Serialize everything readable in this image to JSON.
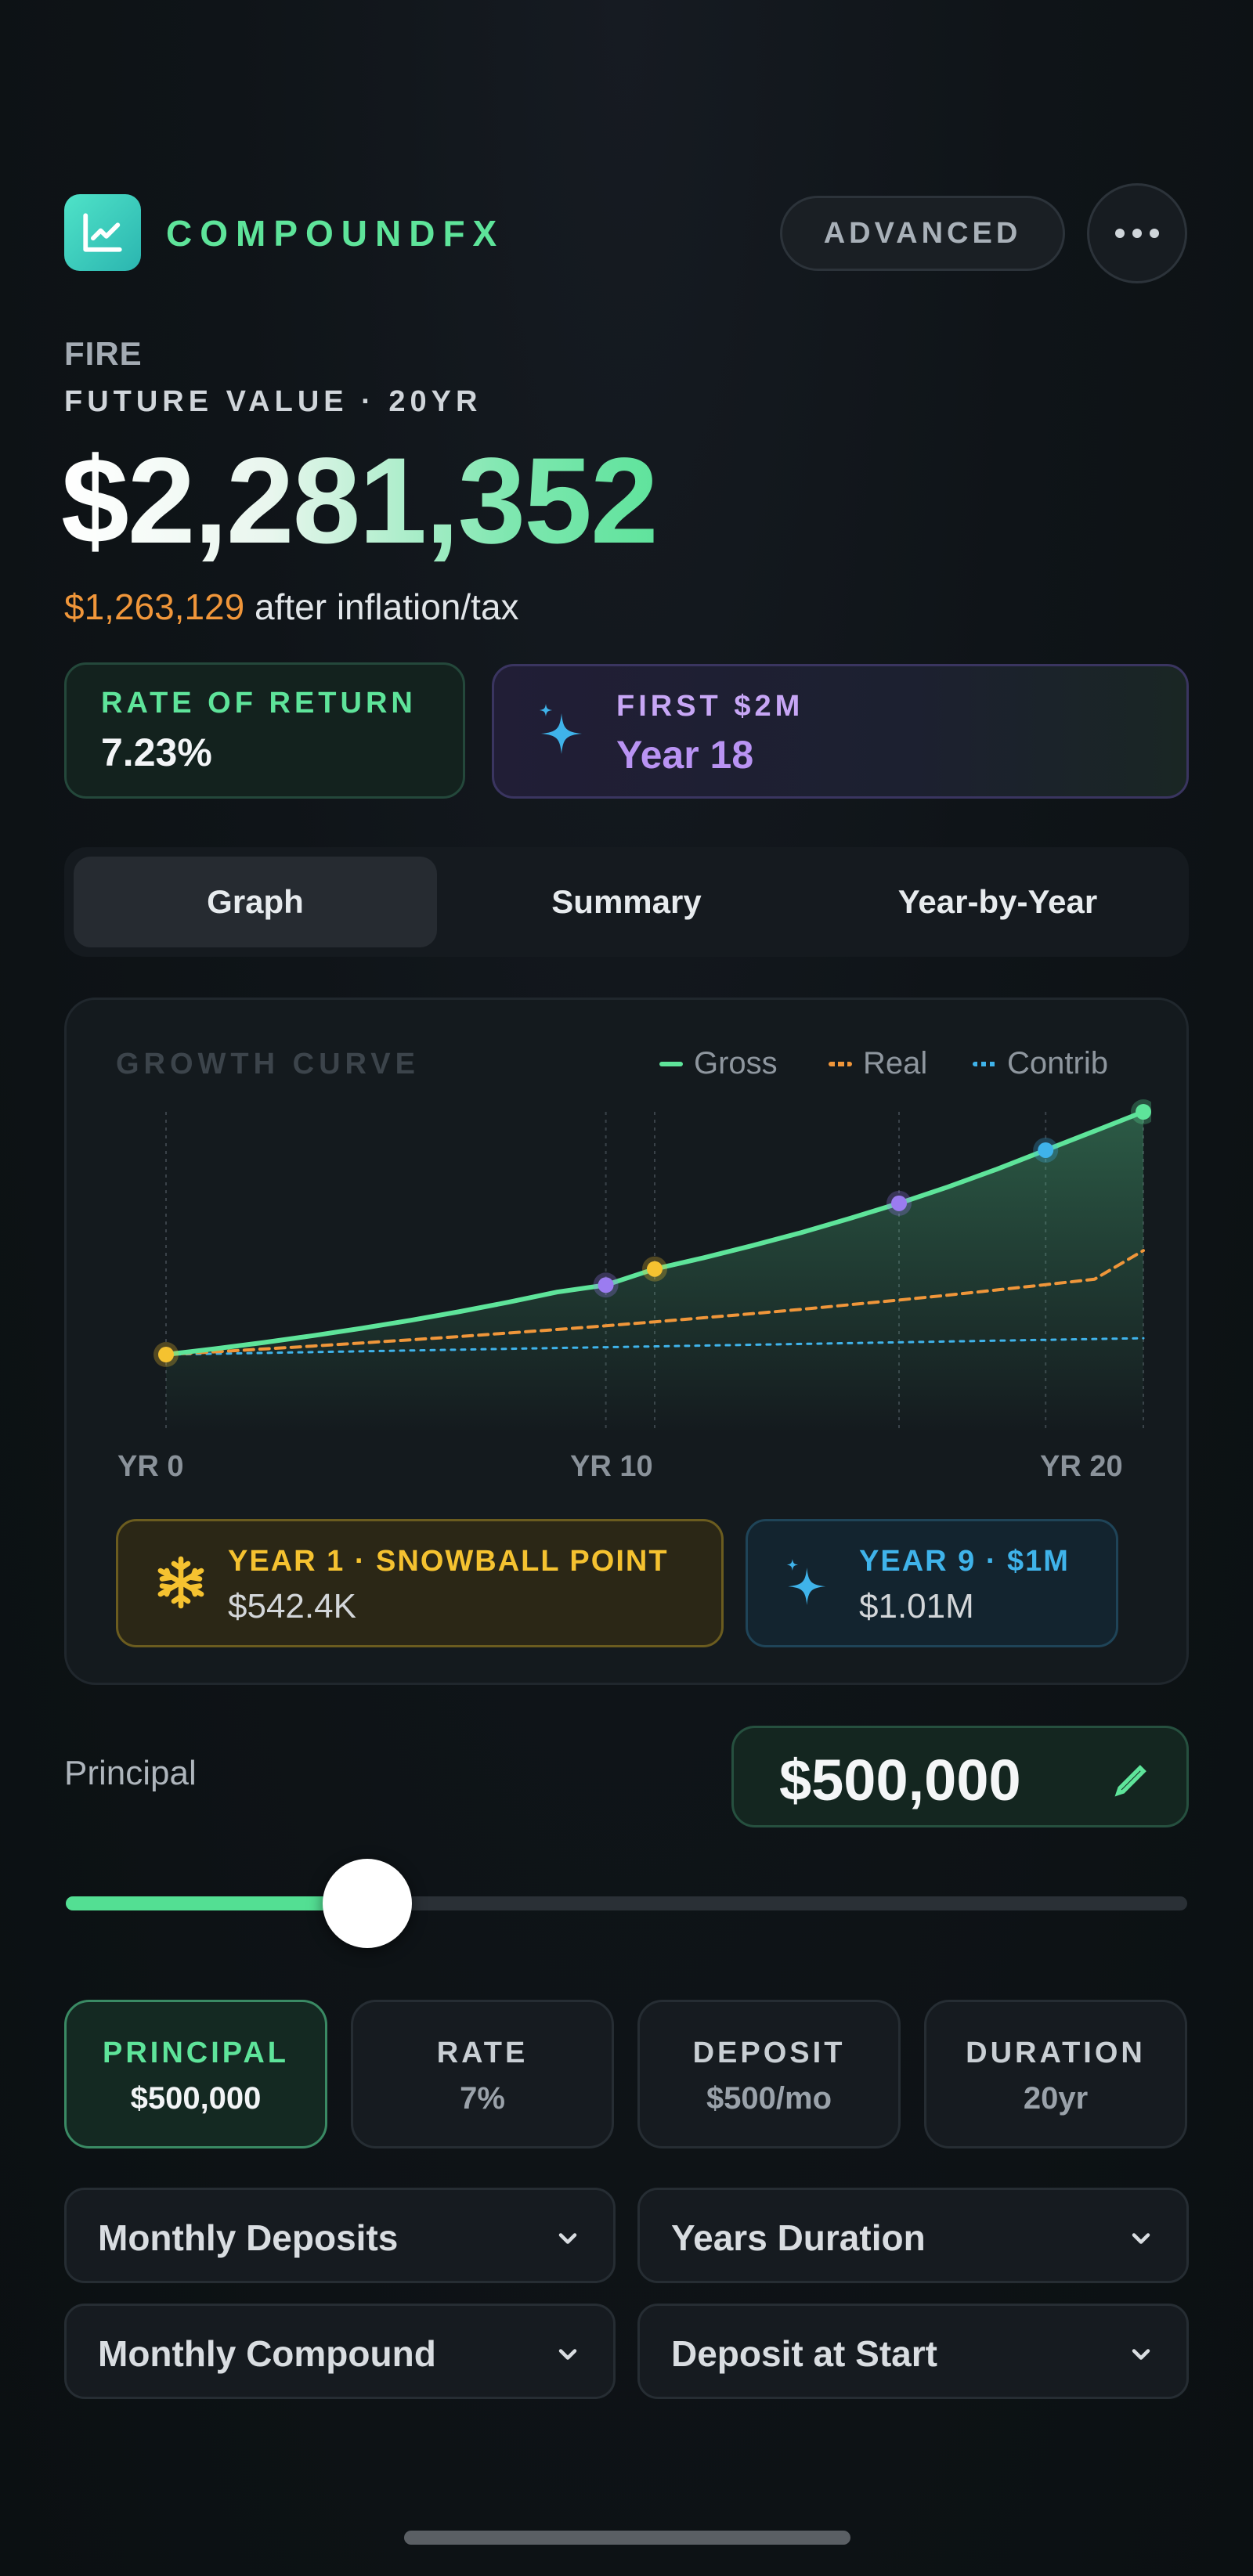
{
  "header": {
    "brand": "COMPOUNDFX",
    "advanced_label": "ADVANCED",
    "logo_icon": "chart-line-icon",
    "more_icon": "more-dots-icon"
  },
  "summary": {
    "mode_label": "FIRE",
    "fv_label": "FUTURE VALUE · 20YR",
    "future_value": "$2,281,352",
    "adjusted_value": "$1,263,129",
    "adjusted_suffix": "after inflation/tax"
  },
  "stats": {
    "rate_title": "RATE OF RETURN",
    "rate_value": "7.23%",
    "milestone_title": "FIRST $2M",
    "milestone_value": "Year 18",
    "milestone_icon": "sparkle-icon"
  },
  "tabs": [
    {
      "label": "Graph",
      "active": true
    },
    {
      "label": "Summary",
      "active": false
    },
    {
      "label": "Year-by-Year",
      "active": false
    }
  ],
  "graph": {
    "title": "GROWTH CURVE",
    "legend": [
      {
        "label": "Gross",
        "color": "#5ee49a",
        "style": "solid"
      },
      {
        "label": "Real",
        "color": "#f0963a",
        "style": "dashed"
      },
      {
        "label": "Contrib",
        "color": "#3fb3ea",
        "style": "dotted"
      }
    ],
    "axis_labels": {
      "start": "YR 0",
      "mid": "YR 10",
      "end": "YR 20"
    },
    "snowball": {
      "title": "YEAR 1 · SNOWBALL POINT",
      "value": "$542.4K",
      "icon": "snowflake-icon"
    },
    "million": {
      "title": "YEAR 9 · $1M",
      "value": "$1.01M",
      "icon": "sparkle-icon"
    }
  },
  "chart_data": {
    "type": "line",
    "title": "GROWTH CURVE",
    "x": [
      0,
      1,
      2,
      3,
      4,
      5,
      6,
      7,
      8,
      9,
      10,
      11,
      12,
      13,
      14,
      15,
      16,
      17,
      18,
      19,
      20
    ],
    "x_tick_labels": [
      "YR 0",
      "YR 10",
      "YR 20"
    ],
    "xlim": [
      0,
      20
    ],
    "ylim": [
      0,
      2400000
    ],
    "grid": false,
    "legend_position": "top-right",
    "series": [
      {
        "name": "Gross",
        "color": "#5ee49a",
        "style": "solid",
        "values": [
          500000,
          542400,
          588400,
          638300,
          692400,
          751000,
          814700,
          883700,
          958600,
          1010000,
          1128000,
          1210000,
          1300000,
          1395000,
          1500000,
          1610000,
          1730000,
          1860000,
          2000000,
          2140000,
          2281352
        ]
      },
      {
        "name": "Real",
        "color": "#f0963a",
        "style": "dashed",
        "values": [
          500000,
          520000,
          541000,
          562000,
          585000,
          608000,
          632000,
          658000,
          684000,
          711000,
          740000,
          770000,
          800000,
          832000,
          866000,
          900000,
          936000,
          974000,
          1013000,
          1053000,
          1263129
        ]
      },
      {
        "name": "Contrib",
        "color": "#3fb3ea",
        "style": "dotted",
        "values": [
          500000,
          506000,
          512000,
          518000,
          524000,
          530000,
          536000,
          542000,
          548000,
          554000,
          560000,
          566000,
          572000,
          578000,
          584000,
          590000,
          596000,
          602000,
          608000,
          614000,
          620000
        ]
      }
    ],
    "markers": [
      {
        "x": 0,
        "series": "Gross",
        "color": "#f5c230"
      },
      {
        "x": 9,
        "series": "Gross",
        "color": "#9b7cf0"
      },
      {
        "x": 10,
        "series": "Gross",
        "color": "#f5c230"
      },
      {
        "x": 15,
        "series": "Gross",
        "color": "#9b7cf0"
      },
      {
        "x": 18,
        "series": "Gross",
        "color": "#3fb3ea"
      },
      {
        "x": 20,
        "series": "Gross",
        "color": "#5ee49a"
      }
    ]
  },
  "principal": {
    "label": "Principal",
    "value": "$500,000",
    "slider_fraction": 0.27,
    "edit_icon": "pencil-icon"
  },
  "chips": [
    {
      "title": "PRINCIPAL",
      "value": "$500,000",
      "active": true
    },
    {
      "title": "RATE",
      "value": "7%",
      "active": false
    },
    {
      "title": "DEPOSIT",
      "value": "$500/mo",
      "active": false
    },
    {
      "title": "DURATION",
      "value": "20yr",
      "active": false
    }
  ],
  "dropdowns": [
    {
      "label": "Monthly Deposits"
    },
    {
      "label": "Years Duration"
    },
    {
      "label": "Monthly Compound"
    },
    {
      "label": "Deposit at Start"
    }
  ],
  "colors": {
    "accent_green": "#5ee49a",
    "accent_orange": "#f0963a",
    "accent_purple": "#b993f3",
    "accent_blue": "#3fb3ea",
    "accent_yellow": "#f5c230"
  }
}
